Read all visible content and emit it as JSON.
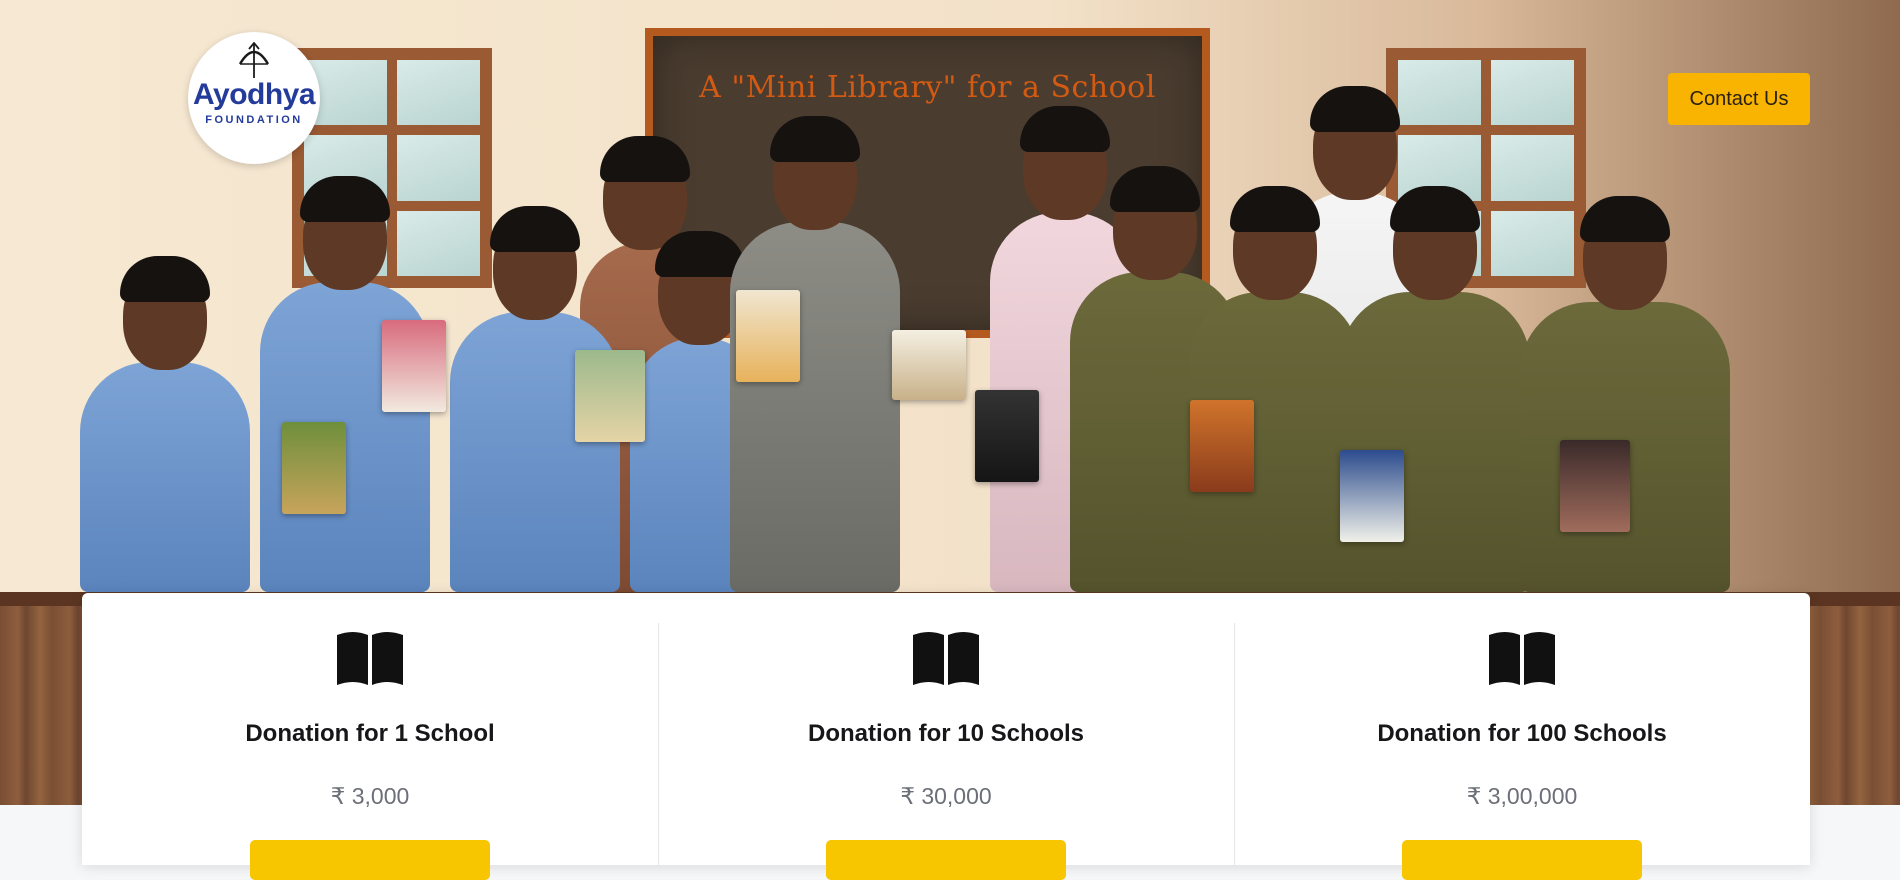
{
  "header": {
    "logo": {
      "name": "Ayodhya",
      "subtitle": "FOUNDATION",
      "icon": "bow-and-arrow-icon"
    },
    "contact_label": "Contact Us"
  },
  "hero": {
    "board_title": "A \"Mini Library\" for a School"
  },
  "donations": [
    {
      "icon": "open-book-icon",
      "title": "Donation for 1 School",
      "price": "₹ 3,000"
    },
    {
      "icon": "open-book-icon",
      "title": "Donation for 10 Schools",
      "price": "₹ 30,000"
    },
    {
      "icon": "open-book-icon",
      "title": "Donation for 100 Schools",
      "price": "₹ 3,00,000"
    }
  ],
  "colors": {
    "accent": "#f8b400",
    "donate_button": "#f7c600",
    "logo_blue": "#233b9a",
    "board_title": "#d35a12"
  }
}
